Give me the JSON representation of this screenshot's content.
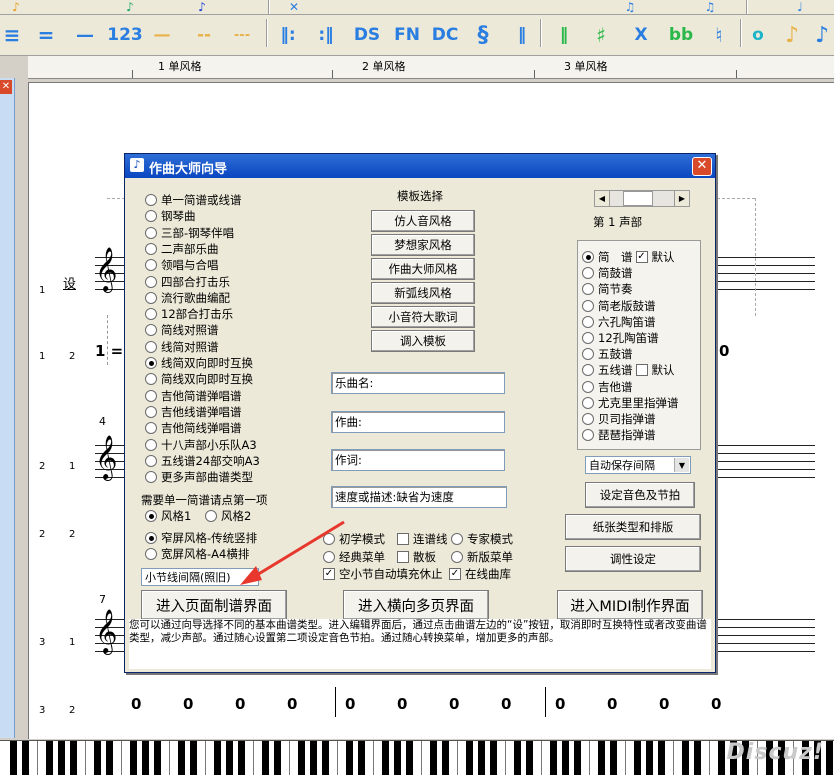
{
  "toolbar2": [
    "123",
    "DS",
    "FN",
    "DC",
    "X",
    "bb",
    "♪",
    "♪"
  ],
  "ruler": [
    "1 单风格",
    "2 单风格",
    "3 单风格"
  ],
  "score": {
    "lyric_char": "设",
    "numbered_start": "1 = C",
    "measure_nums": [
      "4",
      "7"
    ],
    "row_nums": [
      [
        "1",
        "1"
      ],
      [
        "1",
        "2"
      ],
      [
        "2",
        "1"
      ],
      [
        "2",
        "2"
      ],
      [
        "3",
        "1"
      ],
      [
        "3",
        "2"
      ]
    ],
    "rest_zero": "0"
  },
  "watermark": "Discuz!",
  "dialog": {
    "title": "作曲大师向导",
    "close": "✕",
    "types": [
      "单一简谱或线谱",
      "钢琴曲",
      "三部-钢琴伴唱",
      "二声部乐曲",
      "领唱与合唱",
      "四部合打击乐",
      "流行歌曲编配",
      "12部合打击乐",
      "简线对照谱",
      "线简对照谱",
      "线简双向即时互换",
      "简线双向即时互换",
      "吉他简谱弹唱谱",
      "吉他线谱弹唱谱",
      "吉他简线弹唱谱",
      "十八声部小乐队A3",
      "五线谱24部交响A3",
      "更多声部曲谱类型"
    ],
    "types_selected": 10,
    "single_hint": "需要单一简谱请点第一项",
    "style1": "风格1",
    "style2": "风格2",
    "narrow": "窄屏风格-传统竖排",
    "wide": "宽屏风格-A4横排",
    "measure_spacing": "小节线间隔(照旧)",
    "template_title": "模板选择",
    "templates": [
      "仿人音风格",
      "梦想家风格",
      "作曲大师风格",
      "新弧线风格",
      "小音符大歌词",
      "调入模板"
    ],
    "fields": {
      "song_name": "乐曲名:",
      "composer": "作曲:",
      "lyricist": "作词:",
      "tempo": "速度或描述:缺省为速度"
    },
    "modes": {
      "beginner": "初学模式",
      "staccato": "连谱线",
      "expert": "专家模式",
      "classic_menu": "经典菜单",
      "loose": "散板",
      "new_menu": "新版菜单",
      "autofill": "空小节自动填充休止",
      "online": "在线曲库"
    },
    "voice_label": "第 1 声部",
    "voices": [
      "简　谱",
      "简鼓谱",
      "简节奏",
      "简老版鼓谱",
      "六孔陶笛谱",
      "12孔陶笛谱",
      "五鼓谱",
      "五线谱",
      "吉他谱",
      "尤克里里指弹谱",
      "贝司指弹谱",
      "琵琶指弹谱"
    ],
    "voice_default": "默认",
    "autosave": "自动保存间隔",
    "tone_btn": "设定音色及节拍",
    "paper_btn": "纸张类型和排版",
    "key_btn": "调性设定",
    "enter_page": "进入页面制谱界面",
    "enter_horiz": "进入横向多页界面",
    "enter_midi": "进入MIDI制作界面",
    "info": "您可以通过向导选择不同的基本曲谱类型。进入编辑界面后，通过点击曲谱左边的“设”按钮，取消即时互换特性或者改变曲谱类型，减少声部。通过随心设置第二项设定音色节拍。通过随心转换菜单，增加更多的声部。"
  },
  "colors": {
    "accent": "#2a7de1",
    "arrow": "#e8382e",
    "title": "#0a46c0"
  }
}
